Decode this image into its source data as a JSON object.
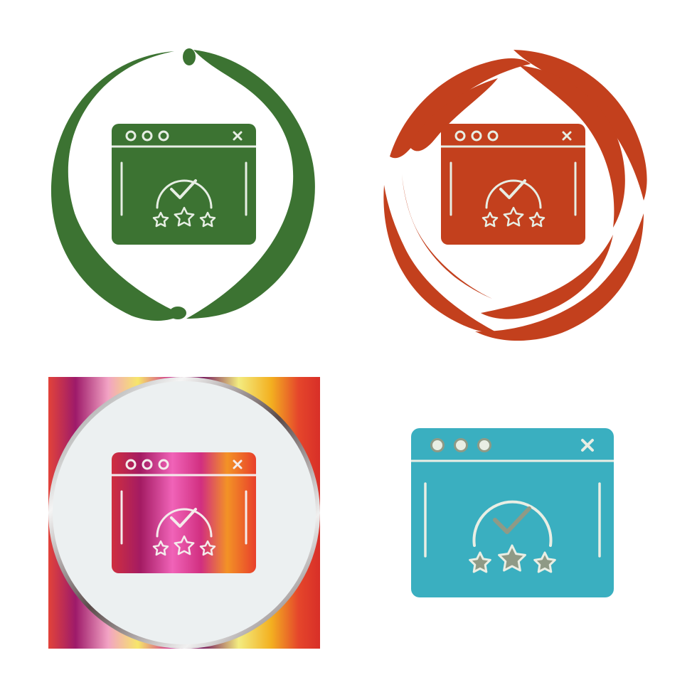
{
  "variants": [
    {
      "style": "green-circle-swoosh",
      "icon": "browser-rating-icon",
      "color": "#3c7332"
    },
    {
      "style": "red-circle-swoosh",
      "icon": "browser-rating-icon",
      "color": "#c3401d"
    },
    {
      "style": "gradient-square-with-circle",
      "icon": "browser-rating-icon",
      "color": "gradient"
    },
    {
      "style": "flat-blue",
      "icon": "browser-rating-icon",
      "color": "#3aafc0"
    }
  ],
  "colors": {
    "green": "#3c7332",
    "red": "#c3401d",
    "blue": "#3aafc0",
    "line_light": "#e7eee4",
    "line_blue": "#e9eee4",
    "disc": "#ecf0f1"
  }
}
